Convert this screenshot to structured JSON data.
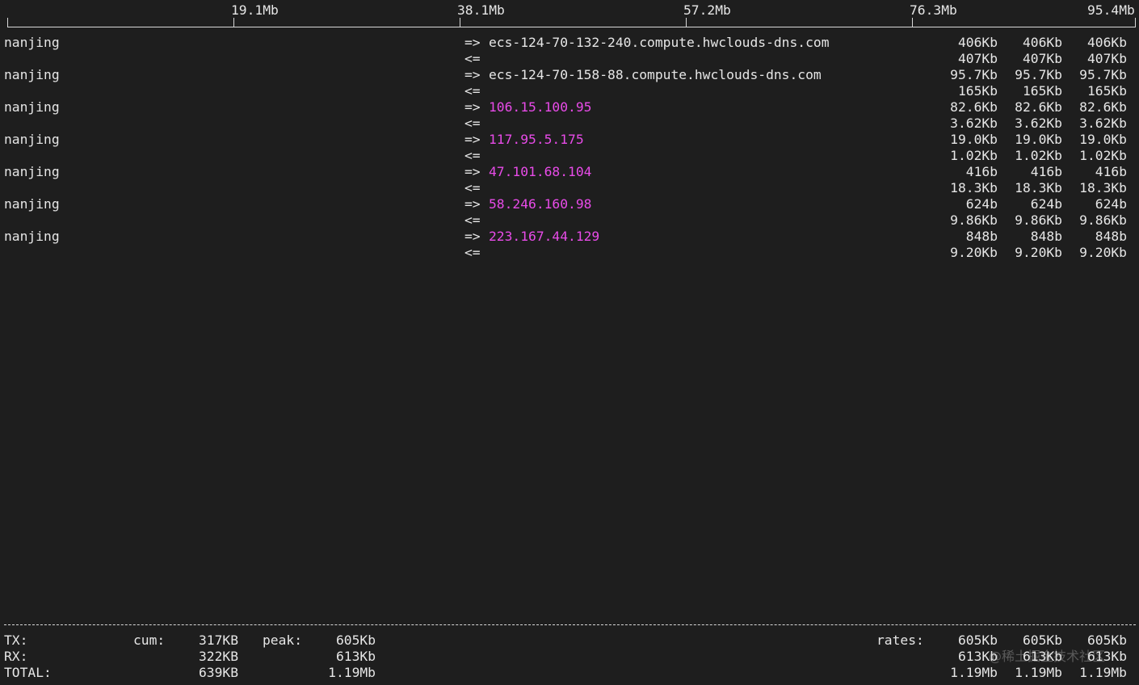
{
  "scale": {
    "ticks": [
      "19.1Mb",
      "38.1Mb",
      "57.2Mb",
      "76.3Mb",
      "95.4Mb"
    ]
  },
  "rows": [
    {
      "src": "nanjing",
      "send_arrow": "=>",
      "recv_arrow": "<=",
      "dest": "ecs-124-70-132-240.compute.hwclouds-dns.com",
      "dest_color": "#e6e6e6",
      "tx": [
        "406Kb",
        "406Kb",
        "406Kb"
      ],
      "rx": [
        "407Kb",
        "407Kb",
        "407Kb"
      ]
    },
    {
      "src": "nanjing",
      "send_arrow": "=>",
      "recv_arrow": "<=",
      "dest": "ecs-124-70-158-88.compute.hwclouds-dns.com",
      "dest_color": "#e6e6e6",
      "tx": [
        "95.7Kb",
        "95.7Kb",
        "95.7Kb"
      ],
      "rx": [
        "165Kb",
        "165Kb",
        "165Kb"
      ]
    },
    {
      "src": "nanjing",
      "send_arrow": "=>",
      "recv_arrow": "<=",
      "dest": "106.15.100.95",
      "dest_color": "#e84be8",
      "tx": [
        "82.6Kb",
        "82.6Kb",
        "82.6Kb"
      ],
      "rx": [
        "3.62Kb",
        "3.62Kb",
        "3.62Kb"
      ]
    },
    {
      "src": "nanjing",
      "send_arrow": "=>",
      "recv_arrow": "<=",
      "dest": "117.95.5.175",
      "dest_color": "#e84be8",
      "tx": [
        "19.0Kb",
        "19.0Kb",
        "19.0Kb"
      ],
      "rx": [
        "1.02Kb",
        "1.02Kb",
        "1.02Kb"
      ]
    },
    {
      "src": "nanjing",
      "send_arrow": "=>",
      "recv_arrow": "<=",
      "dest": "47.101.68.104",
      "dest_color": "#e84be8",
      "tx": [
        "416b",
        "416b",
        "416b"
      ],
      "rx": [
        "18.3Kb",
        "18.3Kb",
        "18.3Kb"
      ]
    },
    {
      "src": "nanjing",
      "send_arrow": "=>",
      "recv_arrow": "<=",
      "dest": "58.246.160.98",
      "dest_color": "#e84be8",
      "tx": [
        "624b",
        "624b",
        "624b"
      ],
      "rx": [
        "9.86Kb",
        "9.86Kb",
        "9.86Kb"
      ]
    },
    {
      "src": "nanjing",
      "send_arrow": "=>",
      "recv_arrow": "<=",
      "dest": "223.167.44.129",
      "dest_color": "#e84be8",
      "tx": [
        "848b",
        "848b",
        "848b"
      ],
      "rx": [
        "9.20Kb",
        "9.20Kb",
        "9.20Kb"
      ]
    }
  ],
  "footer": {
    "tx_label": "TX:",
    "rx_label": "RX:",
    "total_label": "TOTAL:",
    "cum_label": "cum:",
    "peak_label": "peak:",
    "rates_label": "rates:",
    "cum": {
      "tx": "317KB",
      "rx": "322KB",
      "total": "639KB"
    },
    "peak": {
      "tx": "605Kb",
      "rx": "613Kb",
      "total": "1.19Mb"
    },
    "rates": {
      "tx": [
        "605Kb",
        "605Kb",
        "605Kb"
      ],
      "rx": [
        "613Kb",
        "613Kb",
        "613Kb"
      ],
      "total": [
        "1.19Mb",
        "1.19Mb",
        "1.19Mb"
      ]
    }
  },
  "watermark": "@稀土掘金技术社区",
  "colors": {
    "background": "#1e1e1e",
    "foreground": "#e6e6e6",
    "ip_highlight": "#e84be8"
  }
}
